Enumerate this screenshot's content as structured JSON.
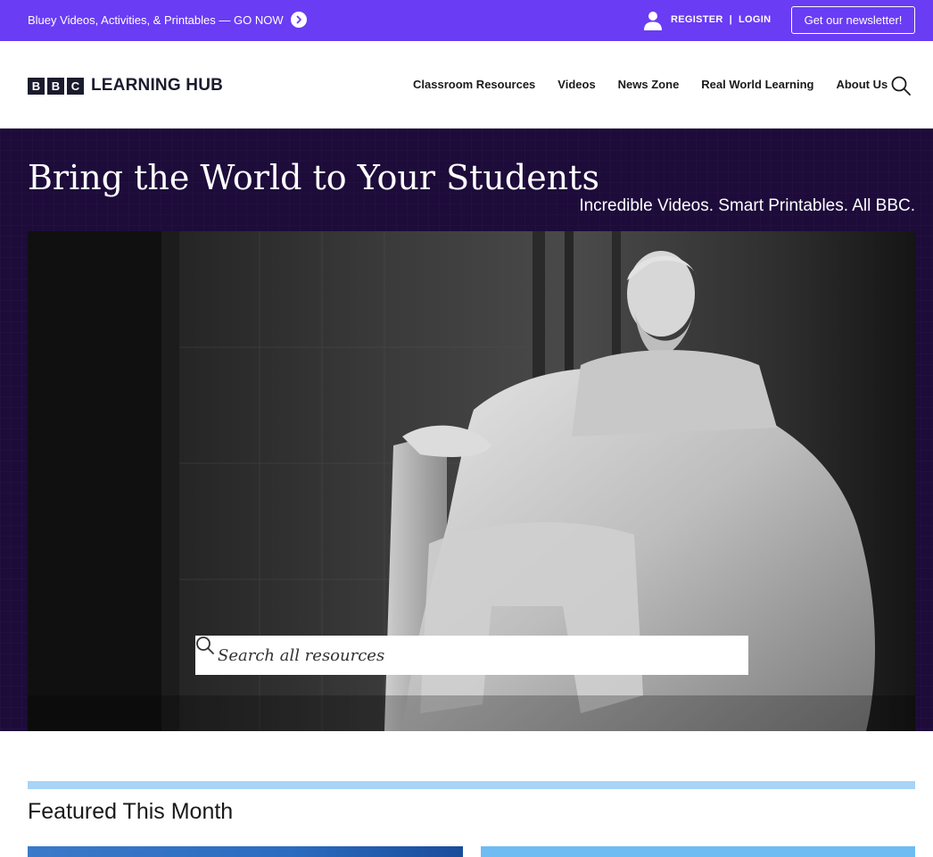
{
  "promo": {
    "text": "Bluey Videos, Activities, & Printables — GO NOW",
    "arrow_icon": "chevron-right-circle-icon"
  },
  "account": {
    "register_label": "REGISTER",
    "separator": "|",
    "login_label": "LOGIN",
    "user_icon": "user-icon"
  },
  "newsletter": {
    "label": "Get our newsletter!"
  },
  "logo": {
    "blocks": [
      "B",
      "B",
      "C"
    ],
    "text": "LEARNING HUB"
  },
  "nav": {
    "items": [
      {
        "label": "Classroom Resources"
      },
      {
        "label": "Videos"
      },
      {
        "label": "News Zone"
      },
      {
        "label": "Real World Learning"
      },
      {
        "label": "About Us"
      }
    ],
    "search_icon": "search-icon"
  },
  "hero": {
    "title": "Bring the World to Your Students",
    "subtitle": "Incredible Videos. Smart Printables. All BBC.",
    "search_placeholder": "Search all resources"
  },
  "featured": {
    "title": "Featured This Month"
  },
  "colors": {
    "promo_bg": "#6a3cf4",
    "hero_bg": "#1d0b3a",
    "featured_bar": "#a7d4f7",
    "logo_dark": "#1b1b2e"
  }
}
